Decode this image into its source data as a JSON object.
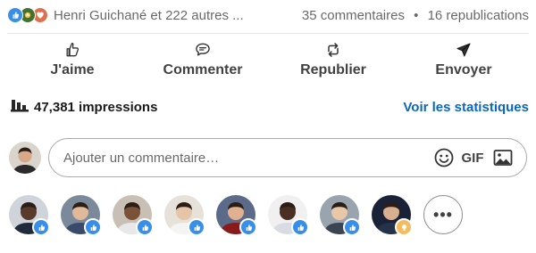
{
  "social_counts": {
    "reaction_icons": [
      "like-icon",
      "celebrate-icon",
      "love-icon"
    ],
    "reactions_text": "Henri Guichané et 222 autres ...",
    "comments": "35 commentaires",
    "separator": "•",
    "reposts": "16 republications"
  },
  "actions": [
    {
      "label": "J'aime",
      "icon": "thumbs-up-icon"
    },
    {
      "label": "Commenter",
      "icon": "comment-icon"
    },
    {
      "label": "Republier",
      "icon": "repost-icon"
    },
    {
      "label": "Envoyer",
      "icon": "send-icon"
    }
  ],
  "impressions": {
    "icon": "bar-chart-icon",
    "text": "47,381 impressions",
    "link": "Voir les statistiques"
  },
  "comment_box": {
    "placeholder": "Ajouter un commentaire…",
    "emoji_icon": "emoji-icon",
    "gif_label": "GIF",
    "image_icon": "image-icon"
  },
  "reactors": [
    {
      "skin": "#5a3a2a",
      "shirt": "#1f2a3a",
      "bg": "#cfd4da",
      "reaction": "like"
    },
    {
      "skin": "#e0b89a",
      "shirt": "#3a4a6a",
      "bg": "#7a8a9a",
      "reaction": "like"
    },
    {
      "skin": "#7a5238",
      "shirt": "#e8e8e8",
      "bg": "#c8c0b4",
      "reaction": "like"
    },
    {
      "skin": "#e6c4a8",
      "shirt": "#f4f4f0",
      "bg": "#e6e2da",
      "reaction": "like"
    },
    {
      "skin": "#e0b090",
      "shirt": "#8a1a1a",
      "bg": "#5a6a88",
      "reaction": "like"
    },
    {
      "skin": "#4a3024",
      "shirt": "#d8dce2",
      "bg": "#f0f0f0",
      "reaction": "like"
    },
    {
      "skin": "#e8c8a8",
      "shirt": "#3a4452",
      "bg": "#9aa4ae",
      "reaction": "like"
    },
    {
      "skin": "#d8b090",
      "shirt": "#26324a",
      "bg": "#1a2238",
      "reaction": "insightful"
    }
  ],
  "more_label": "•••",
  "colors": {
    "like": "#378fe9",
    "celebrate": "#44712e",
    "love": "#df704d",
    "insightful": "#f5bb5c",
    "link": "#0a66c2"
  }
}
